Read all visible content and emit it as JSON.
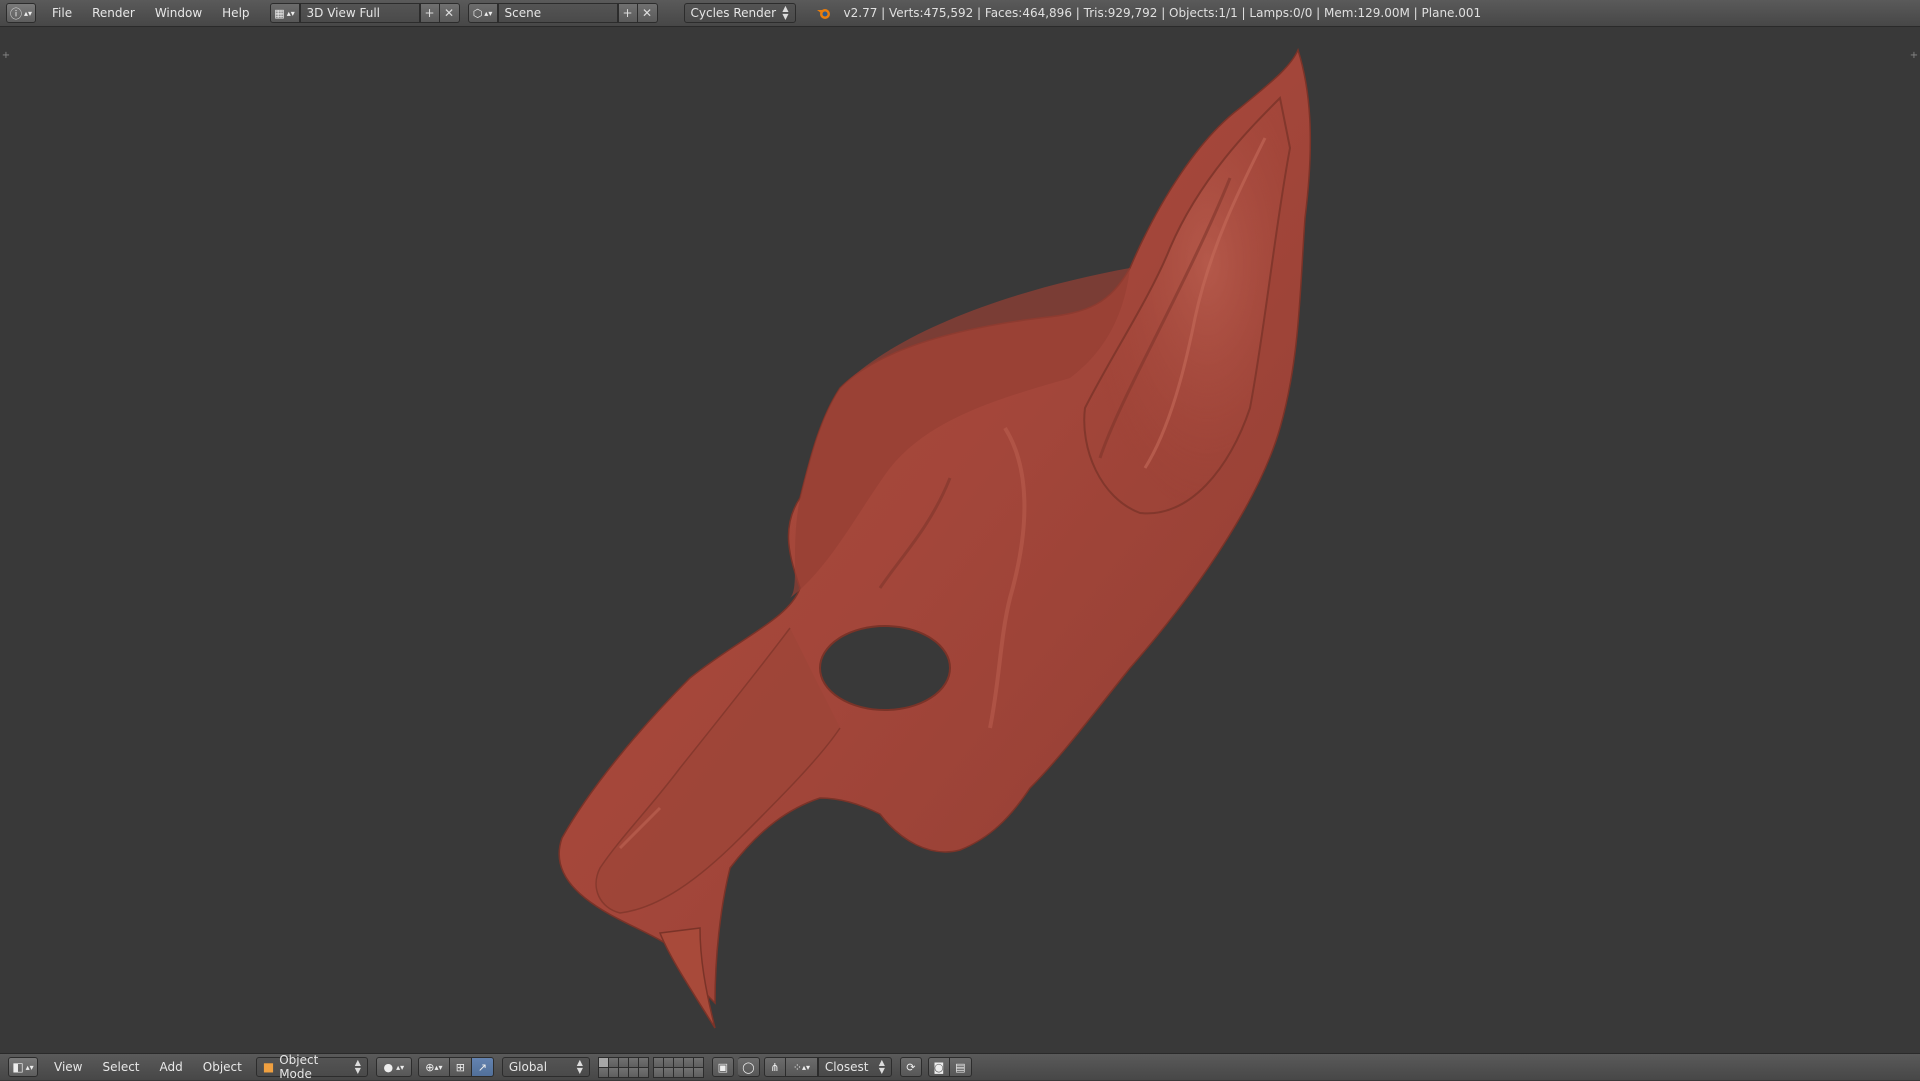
{
  "topbar": {
    "editor_icon": "info-icon",
    "menus": [
      "File",
      "Render",
      "Window",
      "Help"
    ],
    "screen_layout": "3D View Full",
    "scene": "Scene",
    "render_engine": "Cycles Render",
    "stats": "v2.77 | Verts:475,592 | Faces:464,896 | Tris:929,792 | Objects:1/1 | Lamps:0/0 | Mem:129.00M | Plane.001"
  },
  "viewport": {
    "object": "fox-mask-mesh",
    "mesh_color": "#a84a3a",
    "background_color": "#393939"
  },
  "bottombar": {
    "editor_icon": "3d-view-icon",
    "menus": [
      "View",
      "Select",
      "Add",
      "Object"
    ],
    "mode": "Object Mode",
    "orientation": "Global",
    "snap_target": "Closest"
  }
}
